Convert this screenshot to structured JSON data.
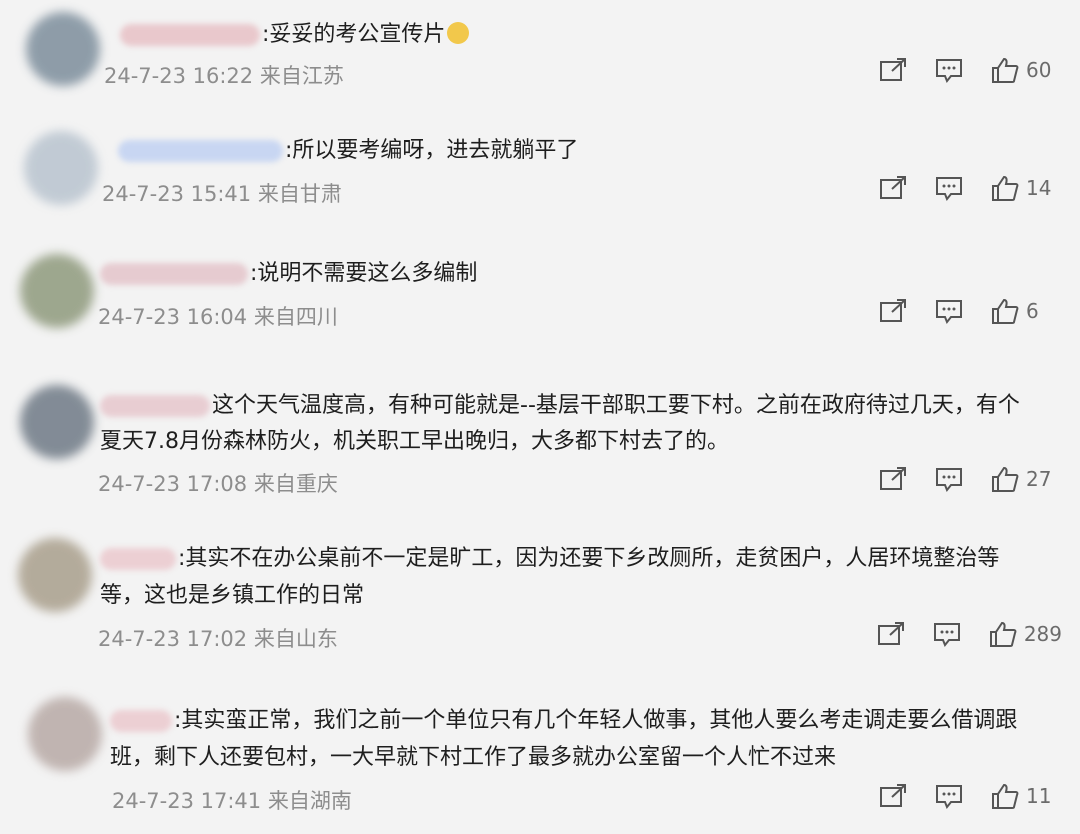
{
  "comments": [
    {
      "avatar_color": "#7d8e9c",
      "username_color": "#e9c8cc",
      "lines": [
        "妥妥的考公宣传片"
      ],
      "emoji_after_line": 0,
      "date": "24-7-23 16:22",
      "location": "来自江苏",
      "likes": "60"
    },
    {
      "avatar_color": "#b9c4cf",
      "username_color": "#c8d6f2",
      "lines": [
        "所以要考编呀，进去就躺平了"
      ],
      "date": "24-7-23 15:41",
      "location": "来自甘肃",
      "likes": "14"
    },
    {
      "avatar_color": "#8f9a7d",
      "username_color": "#e6cbd0",
      "lines": [
        "说明不需要这么多编制"
      ],
      "date": "24-7-23 16:04",
      "location": "来自四川",
      "likes": "6"
    },
    {
      "avatar_color": "#6f7a86",
      "username_color": "#e8cdd2",
      "lines": [
        "这个天气温度高，有种可能就是--基层干部职工要下村。之前在政府待过几天，有个",
        "夏天7.8月份森林防火，机关职工早出晚归，大多都下村去了的。"
      ],
      "date": "24-7-23 17:08",
      "location": "来自重庆",
      "likes": "27"
    },
    {
      "avatar_color": "#a99f8c",
      "username_color": "#eccfd3",
      "lines": [
        "其实不在办公桌前不一定是旷工，因为还要下乡改厕所，走贫困户，人居环境整治等",
        "等，这也是乡镇工作的日常"
      ],
      "date": "24-7-23 17:02",
      "location": "来自山东",
      "likes": "289"
    },
    {
      "avatar_color": "#b8aaa6",
      "username_color": "#eccfd3",
      "lines": [
        "其实蛮正常，我们之前一个单位只有几个年轻人做事，其他人要么考走调走要么借调跟",
        "班，剩下人还要包村，一大早就下村工作了最多就办公室留一个人忙不过来"
      ],
      "emoji_inline": "😭",
      "date": "24-7-23 17:41",
      "location": "来自湖南",
      "likes": "11"
    }
  ],
  "icons": {
    "share": "share-icon",
    "comment": "comment-icon",
    "like": "thumbs-up-icon"
  }
}
